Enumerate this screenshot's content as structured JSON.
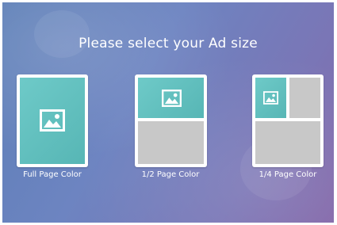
{
  "heading": "Please select your Ad size",
  "options": [
    {
      "label": "Full Page Color",
      "layout": "full"
    },
    {
      "label": "1/2 Page Color",
      "layout": "half"
    },
    {
      "label": "1/4 Page Color",
      "layout": "quarter"
    }
  ],
  "colors": {
    "selected_area": "#5fbfbe",
    "unselected_area": "#c8c8c8",
    "card_border": "#ffffff",
    "background_from": "#5d7fb7",
    "background_to": "#8367a9"
  },
  "icons": [
    "image-icon"
  ]
}
